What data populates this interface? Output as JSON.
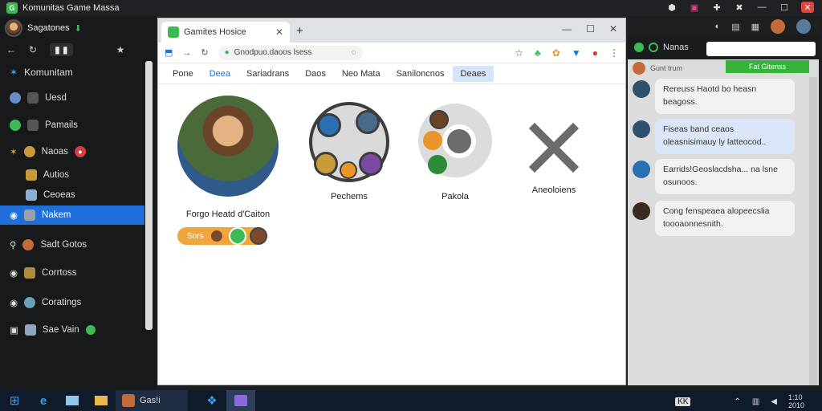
{
  "window": {
    "title": "Komunitas Game Massa"
  },
  "top_icons": [
    "gear-icon",
    "media-icon",
    "puzzle-icon",
    "tools-icon",
    "minimize-icon",
    "maximize-icon",
    "close-icon"
  ],
  "left": {
    "user_name": "Sagatones",
    "nav": {
      "back": "←",
      "reload": "↻",
      "tab_label": "▮ ▮",
      "star": "★"
    },
    "section_title": "Komunitam",
    "items": [
      {
        "label": "Uesd",
        "color": "#6a8cc7"
      },
      {
        "label": "Pamails",
        "color": "#3cba54"
      },
      {
        "label": "Naoas",
        "color": "#d4a23a"
      },
      {
        "label": "Autios",
        "color": "#c89a3a"
      },
      {
        "label": "Ceoeas",
        "color": "#8fb0d0"
      },
      {
        "label": "Nakem",
        "color": "#9aa0a6"
      },
      {
        "label": "Sadt Gotos",
        "color": "#c56b3a"
      },
      {
        "label": "Corrtoss",
        "color": "#b08a40"
      },
      {
        "label": "Coratings",
        "color": "#6aa0b8"
      },
      {
        "label": "Sae Vain",
        "color": "#8fa6bf"
      }
    ]
  },
  "browser": {
    "tab_title": "Gamites Hosice",
    "new_tab": "+",
    "omnibox": "Gnodpuo.daoos lsess",
    "menu": [
      {
        "label": "Pone",
        "state": "normal"
      },
      {
        "label": "Deea",
        "state": "active"
      },
      {
        "label": "Sariadrans",
        "state": "normal"
      },
      {
        "label": "Daos",
        "state": "normal"
      },
      {
        "label": "Neo Mata",
        "state": "normal"
      },
      {
        "label": "Saniloncnos",
        "state": "normal"
      },
      {
        "label": "Deaes",
        "state": "highlight"
      }
    ],
    "games": [
      {
        "label": "Forgo Heatd d'Caiton"
      },
      {
        "label": "Pechems"
      },
      {
        "label": "Pakola"
      },
      {
        "label": "Aneoloiens"
      }
    ],
    "pill_label": "Sors"
  },
  "chat": {
    "search_placeholder": "",
    "header": "Nanas",
    "button": "Fat Gitenss",
    "user": "Gunt trum",
    "messages": [
      {
        "text": "Rereuss Haotd bo heasn beagoss.",
        "bg": "#f2f2f2"
      },
      {
        "text": "Fiseas band ceaos oleasnisimauy ly latteocod..",
        "bg": "#dbe7f8"
      },
      {
        "text": "Earrids!Geoslacdsha... na lsne osunoos.",
        "bg": "#f2f2f2"
      },
      {
        "text": "Cong fenspeaea alopeecslia toooaonnesnith.",
        "bg": "#f2f2f2"
      }
    ]
  },
  "taskbar": {
    "app_label": "Gas!i",
    "tray_kb": "KK",
    "time": "1:10 2010",
    "icons": [
      "start-icon",
      "ie-icon",
      "folder-icon",
      "files-icon"
    ]
  }
}
